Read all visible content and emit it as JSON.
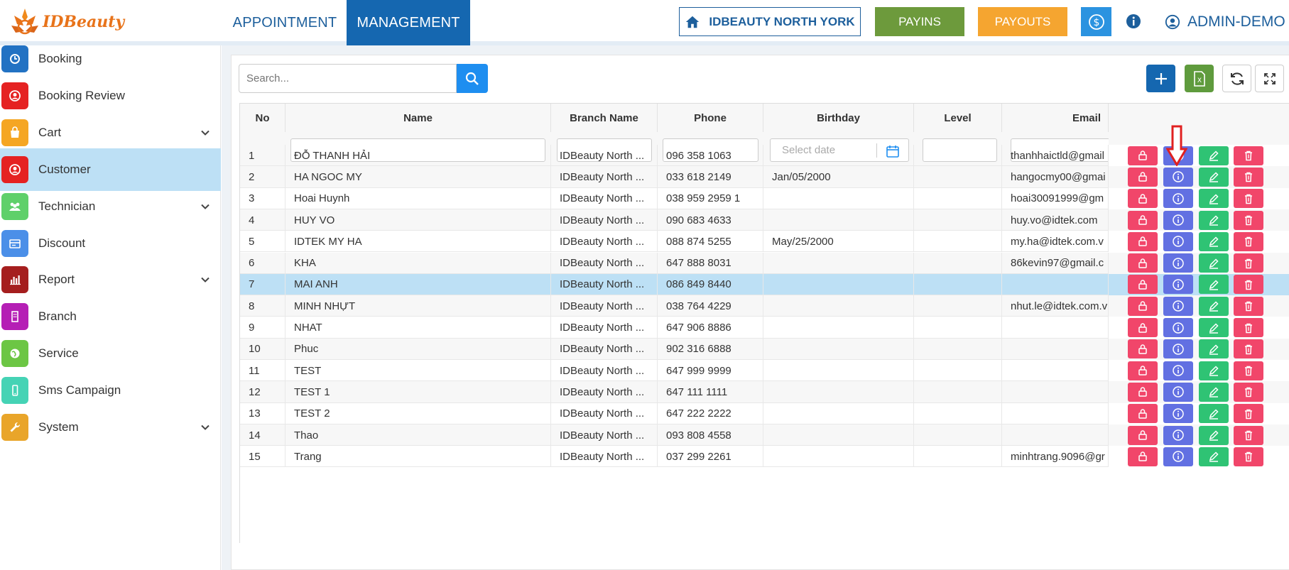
{
  "header": {
    "logo_text": "IDBeauty",
    "nav": [
      {
        "label": "APPOINTMENT",
        "active": false
      },
      {
        "label": "MANAGEMENT",
        "active": true
      }
    ],
    "branch_button": "IDBEAUTY NORTH YORK",
    "payins_button": "PAYINS",
    "payouts_button": "PAYOUTS",
    "dollar_icon": "dollar-circle-icon",
    "info_icon": "info-icon",
    "user_label": "ADMIN-DEMO"
  },
  "sidebar": {
    "items": [
      {
        "label": "Booking",
        "icon": "clock-icon",
        "color": "#2272c3",
        "expandable": false,
        "active": false
      },
      {
        "label": "Booking Review",
        "icon": "user-review-icon",
        "color": "#e52222",
        "expandable": false,
        "active": false
      },
      {
        "label": "Cart",
        "icon": "shopping-bag-icon",
        "color": "#f5a623",
        "expandable": true,
        "active": false
      },
      {
        "label": "Customer",
        "icon": "customer-icon",
        "color": "#e52222",
        "expandable": false,
        "active": true
      },
      {
        "label": "Technician",
        "icon": "group-icon",
        "color": "#5fd06a",
        "expandable": true,
        "active": false
      },
      {
        "label": "Discount",
        "icon": "discount-card-icon",
        "color": "#4b8fe8",
        "expandable": false,
        "active": false
      },
      {
        "label": "Report",
        "icon": "bar-chart-icon",
        "color": "#a51e1e",
        "expandable": true,
        "active": false
      },
      {
        "label": "Branch",
        "icon": "building-icon",
        "color": "#b51fb5",
        "expandable": false,
        "active": false
      },
      {
        "label": "Service",
        "icon": "globe-icon",
        "color": "#6cc644",
        "expandable": false,
        "active": false
      },
      {
        "label": "Sms Campaign",
        "icon": "mobile-icon",
        "color": "#45d3b5",
        "expandable": false,
        "active": false
      },
      {
        "label": "System",
        "icon": "wrench-icon",
        "color": "#e9a52a",
        "expandable": true,
        "active": false
      }
    ]
  },
  "toolbar": {
    "search_placeholder": "Search..."
  },
  "table": {
    "columns": [
      "No",
      "Name",
      "Branch Name",
      "Phone",
      "Birthday",
      "Level",
      "Email"
    ],
    "birthday_placeholder": "Select date",
    "selected_row": 7,
    "rows": [
      {
        "no": "1",
        "name": "ĐỖ THANH HẢI",
        "branch": "IDBeauty North ...",
        "phone": "096 358 1063",
        "birthday": "",
        "level": "",
        "email": "thanhhaictld@gmail"
      },
      {
        "no": "2",
        "name": "HA NGOC MY",
        "branch": "IDBeauty North ...",
        "phone": "033 618 2149",
        "birthday": "Jan/05/2000",
        "level": "",
        "email": "hangocmy00@gmai"
      },
      {
        "no": "3",
        "name": "Hoai Huynh",
        "branch": "IDBeauty North ...",
        "phone": "038 959 2959 1",
        "birthday": "",
        "level": "",
        "email": "hoai30091999@gm"
      },
      {
        "no": "4",
        "name": "HUY VO",
        "branch": "IDBeauty North ...",
        "phone": "090 683 4633",
        "birthday": "",
        "level": "",
        "email": "huy.vo@idtek.com"
      },
      {
        "no": "5",
        "name": "IDTEK MY HA",
        "branch": "IDBeauty North ...",
        "phone": "088 874 5255",
        "birthday": "May/25/2000",
        "level": "",
        "email": "my.ha@idtek.com.v"
      },
      {
        "no": "6",
        "name": "KHA",
        "branch": "IDBeauty North ...",
        "phone": "647 888 8031",
        "birthday": "",
        "level": "",
        "email": "86kevin97@gmail.c"
      },
      {
        "no": "7",
        "name": "MAI ANH",
        "branch": "IDBeauty North ...",
        "phone": "086 849 8440",
        "birthday": "",
        "level": "",
        "email": ""
      },
      {
        "no": "8",
        "name": "MINH NHỰT",
        "branch": "IDBeauty North ...",
        "phone": "038 764 4229",
        "birthday": "",
        "level": "",
        "email": "nhut.le@idtek.com.v"
      },
      {
        "no": "9",
        "name": "NHAT",
        "branch": "IDBeauty North ...",
        "phone": "647 906 8886",
        "birthday": "",
        "level": "",
        "email": ""
      },
      {
        "no": "10",
        "name": "Phuc",
        "branch": "IDBeauty North ...",
        "phone": "902 316 6888",
        "birthday": "",
        "level": "",
        "email": ""
      },
      {
        "no": "11",
        "name": "TEST",
        "branch": "IDBeauty North ...",
        "phone": "647 999 9999",
        "birthday": "",
        "level": "",
        "email": ""
      },
      {
        "no": "12",
        "name": "TEST 1",
        "branch": "IDBeauty North ...",
        "phone": "647 111 1111",
        "birthday": "",
        "level": "",
        "email": ""
      },
      {
        "no": "13",
        "name": "TEST 2",
        "branch": "IDBeauty North ...",
        "phone": "647 222 2222",
        "birthday": "",
        "level": "",
        "email": ""
      },
      {
        "no": "14",
        "name": "Thao",
        "branch": "IDBeauty North ...",
        "phone": "093 808 4558",
        "birthday": "",
        "level": "",
        "email": ""
      },
      {
        "no": "15",
        "name": "Trang",
        "branch": "IDBeauty North ...",
        "phone": "037 299 2261",
        "birthday": "",
        "level": "",
        "email": "minhtrang.9096@gr"
      }
    ],
    "row_actions": [
      {
        "name": "lock",
        "icon": "lock-icon",
        "color": "#f1466a"
      },
      {
        "name": "info",
        "icon": "info-icon",
        "color": "#6270e2"
      },
      {
        "name": "edit",
        "icon": "pencil-icon",
        "color": "#2fc374"
      },
      {
        "name": "delete",
        "icon": "trash-icon",
        "color": "#f1466a"
      }
    ]
  },
  "annotation": {
    "arrow_icon": "red-down-arrow-icon",
    "color": "#e02020"
  }
}
